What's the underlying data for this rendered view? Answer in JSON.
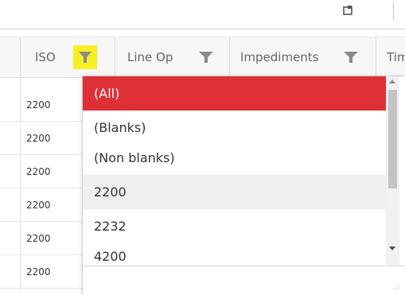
{
  "toolbar": {
    "export_icon": "export-icon"
  },
  "grid": {
    "columns": [
      {
        "label": "ISO",
        "filter_active": true
      },
      {
        "label": "Line Op",
        "filter_active": false
      },
      {
        "label": "Impediments",
        "filter_active": false
      },
      {
        "label": "Tim",
        "filter_active": false
      }
    ],
    "rows": [
      "2200",
      "2200",
      "2200",
      "2200",
      "2200",
      "2200"
    ]
  },
  "filter_dropdown": {
    "items": [
      "(All)",
      "(Blanks)",
      "(Non blanks)",
      "2200",
      "2232",
      "4200"
    ],
    "selected_index": 0,
    "hover_index": 3
  },
  "colors": {
    "selected": "#e03037",
    "filter_active": "#f5f024"
  }
}
